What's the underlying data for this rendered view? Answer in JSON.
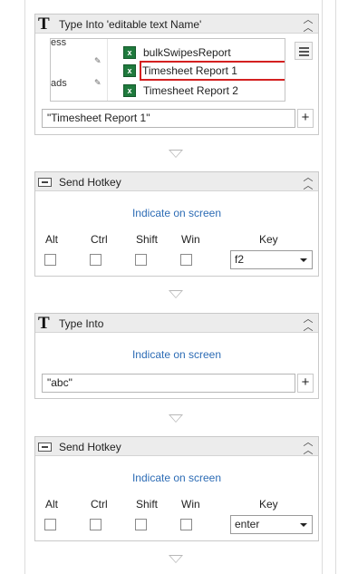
{
  "cards": [
    {
      "title": "Type Into 'editable text  Name'",
      "preview": {
        "left_texts": [
          "ess",
          "ads"
        ],
        "rows": [
          {
            "label": "bulkSwipesReport",
            "selected": false
          },
          {
            "label": "Timesheet Report 1",
            "selected": true
          },
          {
            "label": "Timesheet Report 2",
            "selected": false
          }
        ]
      },
      "input_value": "\"Timesheet Report 1\""
    },
    {
      "title": "Send Hotkey",
      "indicate": "Indicate on screen",
      "modifiers": [
        "Alt",
        "Ctrl",
        "Shift",
        "Win"
      ],
      "key_label": "Key",
      "key_value": "f2"
    },
    {
      "title": "Type Into",
      "indicate": "Indicate on screen",
      "input_value": "\"abc\""
    },
    {
      "title": "Send Hotkey",
      "indicate": "Indicate on screen",
      "modifiers": [
        "Alt",
        "Ctrl",
        "Shift",
        "Win"
      ],
      "key_label": "Key",
      "key_value": "enter"
    }
  ],
  "icons": {
    "type_into": "T",
    "send_hotkey": "keyboard-icon",
    "collapse": "collapse-chevrons-up-icon",
    "plus": "+",
    "excel": "x"
  },
  "colors": {
    "link": "#2d6cb5",
    "selection_border": "#d42020",
    "header_bg": "#ececec",
    "excel_green": "#1f7a3d"
  }
}
